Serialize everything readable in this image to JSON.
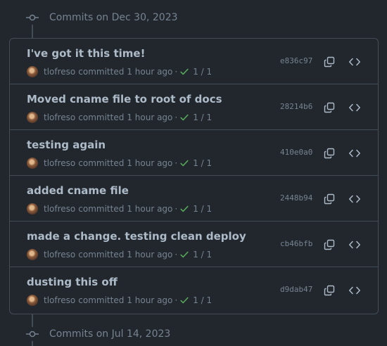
{
  "groups": [
    {
      "title": "Commits on Dec 30, 2023"
    },
    {
      "title": "Commits on Jul 14, 2023"
    }
  ],
  "commits": [
    {
      "message": "I've got it this time!",
      "author": "tlofreso",
      "verb": "committed",
      "time": "1 hour ago",
      "dot": "·",
      "checks": "1 / 1",
      "sha": "e836c97"
    },
    {
      "message": "Moved cname file to root of docs",
      "author": "tlofreso",
      "verb": "committed",
      "time": "1 hour ago",
      "dot": "·",
      "checks": "1 / 1",
      "sha": "28214b6"
    },
    {
      "message": "testing again",
      "author": "tlofreso",
      "verb": "committed",
      "time": "1 hour ago",
      "dot": "·",
      "checks": "1 / 1",
      "sha": "410e0a0"
    },
    {
      "message": "added cname file",
      "author": "tlofreso",
      "verb": "committed",
      "time": "1 hour ago",
      "dot": "·",
      "checks": "1 / 1",
      "sha": "2448b94"
    },
    {
      "message": "made a change. testing clean deploy",
      "author": "tlofreso",
      "verb": "committed",
      "time": "1 hour ago",
      "dot": "·",
      "checks": "1 / 1",
      "sha": "cb46bfb"
    },
    {
      "message": "dusting this off",
      "author": "tlofreso",
      "verb": "committed",
      "time": "1 hour ago",
      "dot": "·",
      "checks": "1 / 1",
      "sha": "d9dab47"
    }
  ],
  "icons": {
    "commit_node": "git-commit-icon",
    "check": "check-icon",
    "copy": "copy-icon",
    "browse": "code-icon"
  },
  "colors": {
    "background": "#22272e",
    "border": "#444c56",
    "text_primary": "#adbac7",
    "text_muted": "#768390",
    "success": "#57ab5a"
  }
}
